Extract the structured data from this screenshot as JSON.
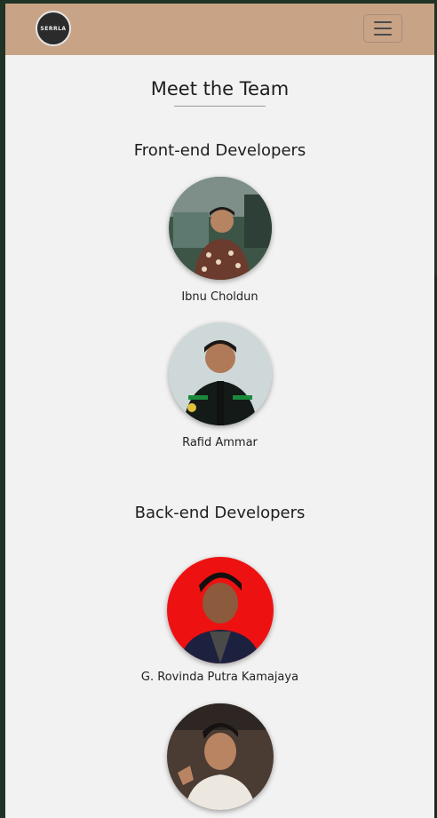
{
  "navbar": {
    "logo_text": "SERRLA",
    "menu_icon": "hamburger-icon",
    "background": "#c8a386"
  },
  "page": {
    "title": "Meet the Team"
  },
  "sections": [
    {
      "title": "Front-end Developers",
      "members": [
        {
          "name": "Ibnu Choldun",
          "photo_bg": "#3d5547"
        },
        {
          "name": "Rafid Ammar",
          "photo_bg": "#cfd8d8"
        }
      ]
    },
    {
      "title": "Back-end Developers",
      "members": [
        {
          "name": "G. Rovinda Putra Kamajaya",
          "photo_bg": "#ee1111"
        },
        {
          "name": "",
          "photo_bg": "#4a3b33"
        }
      ]
    }
  ]
}
